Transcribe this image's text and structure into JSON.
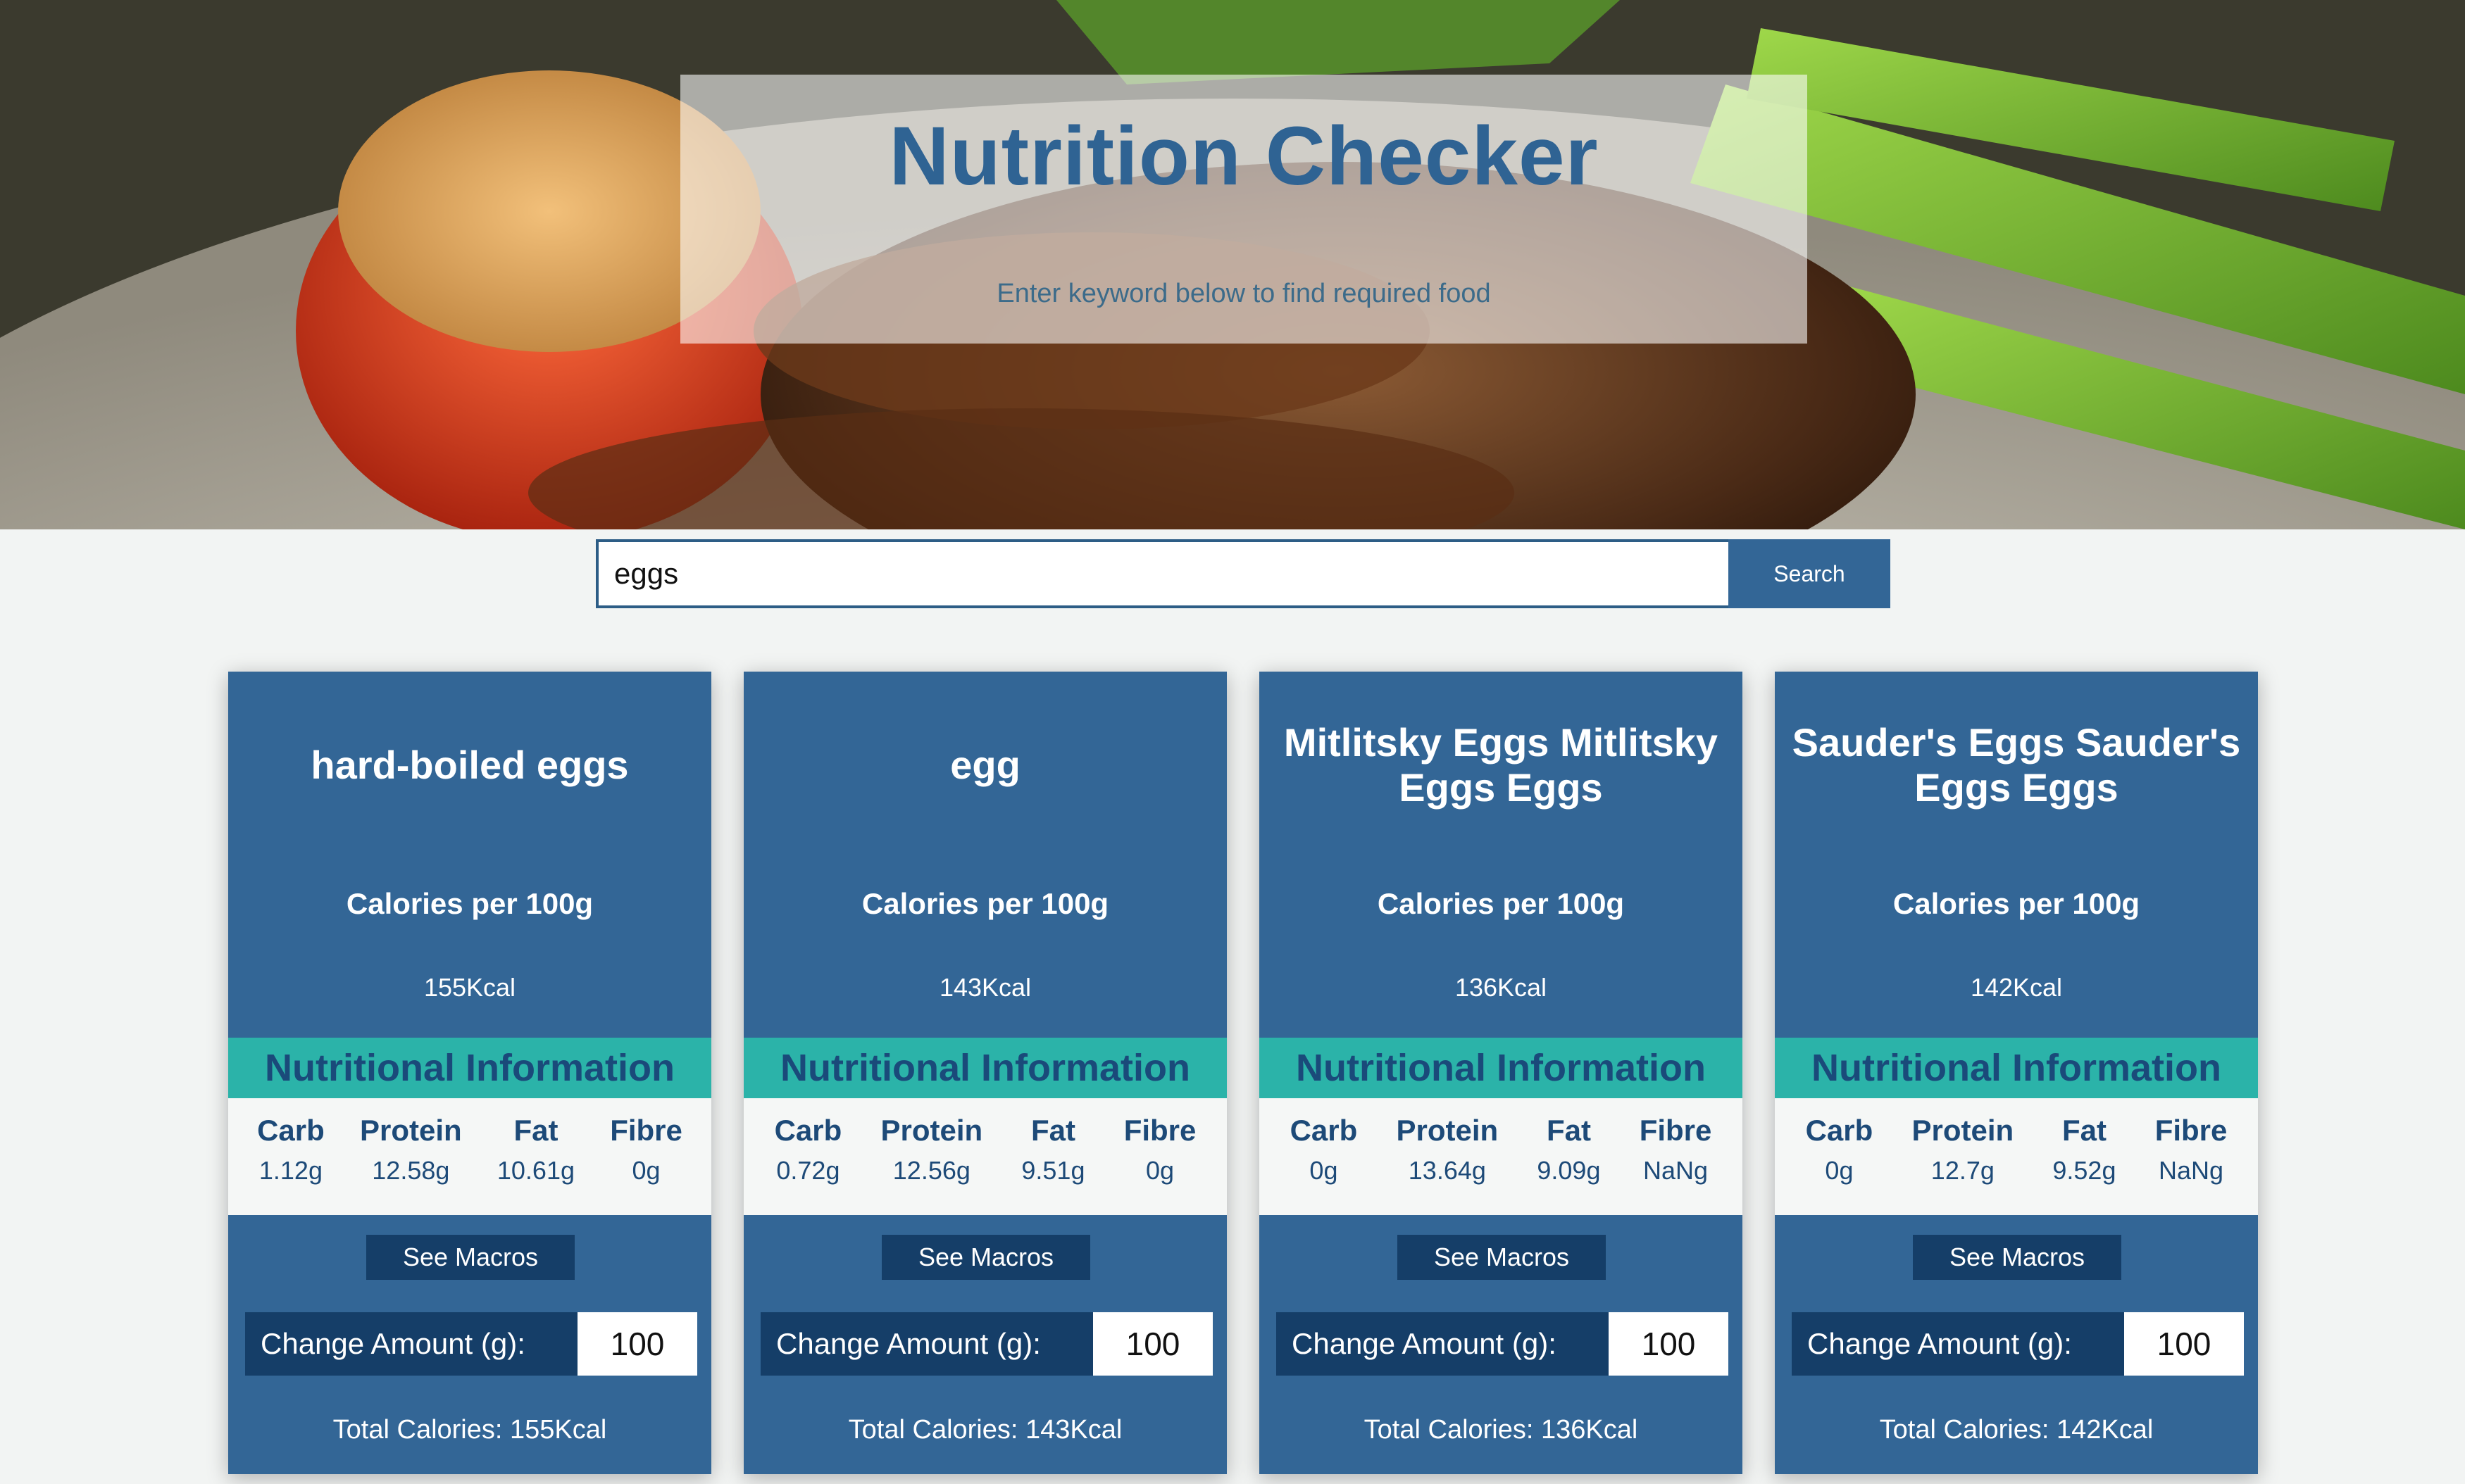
{
  "header": {
    "title": "Nutrition Checker",
    "subtitle": "Enter keyword below to find required food"
  },
  "search": {
    "value": "eggs",
    "button_label": "Search"
  },
  "labels": {
    "calories_per": "Calories per 100g",
    "nutritional_info": "Nutritional Information",
    "carb": "Carb",
    "protein": "Protein",
    "fat": "Fat",
    "fibre": "Fibre",
    "see_macros": "See Macros",
    "change_amount": "Change Amount (g):"
  },
  "cards": [
    {
      "title": "hard-boiled eggs",
      "calories": "155Kcal",
      "carb": "1.12g",
      "protein": "12.58g",
      "fat": "10.61g",
      "fibre": "0g",
      "amount": "100",
      "total": "Total Calories: 155Kcal"
    },
    {
      "title": "egg",
      "calories": "143Kcal",
      "carb": "0.72g",
      "protein": "12.56g",
      "fat": "9.51g",
      "fibre": "0g",
      "amount": "100",
      "total": "Total Calories: 143Kcal"
    },
    {
      "title": "Mitlitsky Eggs Mitlitsky Eggs Eggs",
      "calories": "136Kcal",
      "carb": "0g",
      "protein": "13.64g",
      "fat": "9.09g",
      "fibre": "NaNg",
      "amount": "100",
      "total": "Total Calories: 136Kcal"
    },
    {
      "title": "Sauder's Eggs Sauder's Eggs Eggs",
      "calories": "142Kcal",
      "carb": "0g",
      "protein": "12.7g",
      "fat": "9.52g",
      "fibre": "NaNg",
      "amount": "100",
      "total": "Total Calories: 142Kcal"
    }
  ],
  "colors": {
    "card_blue": "#336696",
    "dark_blue": "#153e68",
    "teal": "#2bb3a9",
    "title_blue": "#2f6393"
  }
}
